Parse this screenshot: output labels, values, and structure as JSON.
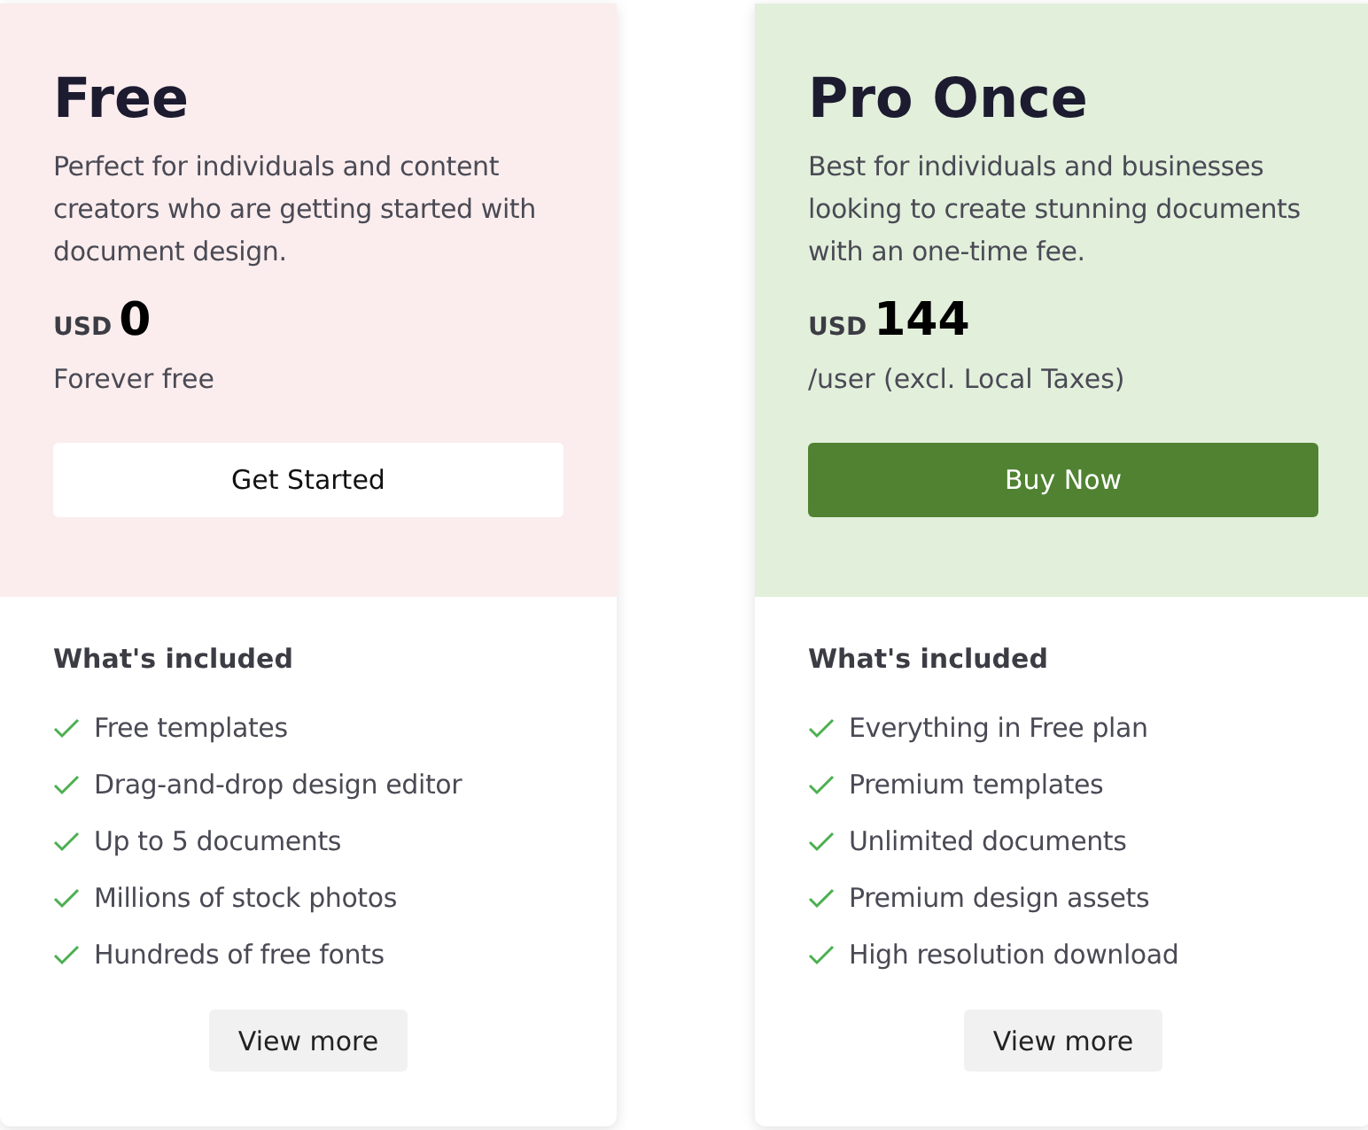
{
  "plans": [
    {
      "kind": "free",
      "name": "Free",
      "description": "Perfect for individuals and content creators who are getting started with document design.",
      "currency": "USD",
      "price": "0",
      "price_note": "Forever free",
      "button": {
        "label": "Get Started",
        "kind": "secondary"
      },
      "included_title": "What's included",
      "features": [
        "Free templates",
        "Drag-and-drop design editor",
        "Up to 5 documents",
        "Millions of stock photos",
        "Hundreds of free fonts"
      ],
      "more_button": "View more"
    },
    {
      "kind": "paid",
      "name": "Pro Once",
      "description": "Best for individuals and businesses looking to create stunning documents with an one-time fee.",
      "currency": "USD",
      "price": "144",
      "price_note": "/user (excl. Local Taxes)",
      "button": {
        "label": "Buy Now",
        "kind": "primary"
      },
      "included_title": "What's included",
      "features": [
        "Everything in Free plan",
        "Premium templates",
        "Unlimited documents",
        "Premium design assets",
        "High resolution download"
      ],
      "more_button": "View more"
    }
  ]
}
